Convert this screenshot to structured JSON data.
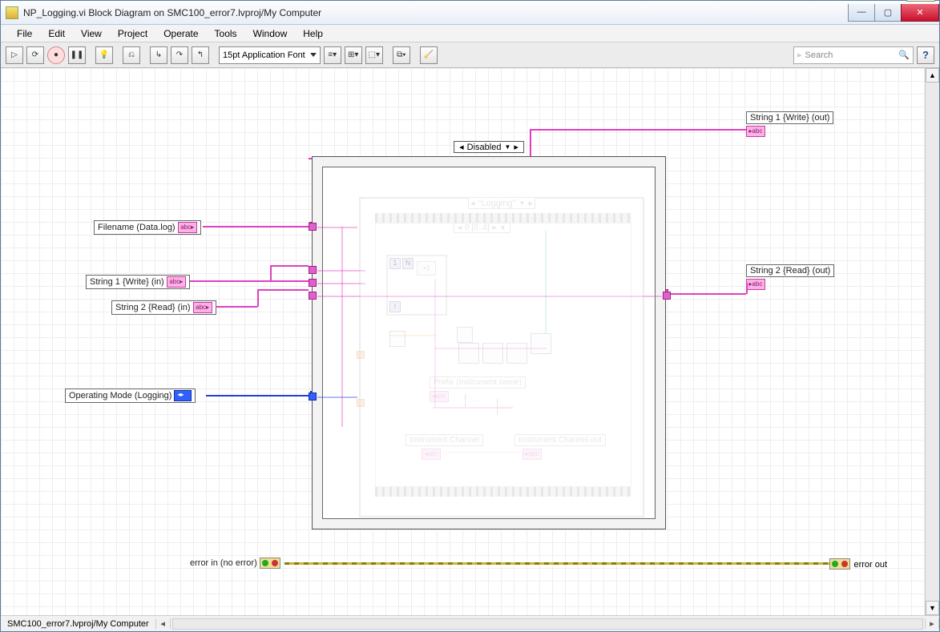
{
  "window": {
    "title": "NP_Logging.vi Block Diagram on SMC100_error7.lvproj/My Computer"
  },
  "menu": {
    "file": "File",
    "edit": "Edit",
    "view": "View",
    "project": "Project",
    "operate": "Operate",
    "tools": "Tools",
    "window": "Window",
    "help": "Help"
  },
  "toolbar": {
    "font": "15pt Application Font",
    "search_placeholder": "Search"
  },
  "corner_icon": "Load&",
  "status": {
    "crumb": "SMC100_error7.lvproj/My Computer"
  },
  "terminals": {
    "filename": "Filename (Data.log)",
    "str1_in": "String 1 {Write} (in)",
    "str2_in": "String 2 {Read} (in)",
    "opmode": "Operating Mode (Logging)",
    "str1_out": "String 1 {Write} (out)",
    "str2_out": "String 2 {Read} (out)",
    "err_in": "error in (no error)",
    "err_out": "error out"
  },
  "structs": {
    "disabled_case": "Disabled",
    "inner_case": "\"Logging\"",
    "seq_frame": "0 [0..4]"
  },
  "inner": {
    "prefix": "Prefix (Instrument name)",
    "chan_in": "Instrument Channel",
    "chan_out": "Instrument Channel out",
    "abc": "abc",
    "one": "1",
    "N": "N",
    "i": "i",
    "plus1": "+1"
  }
}
